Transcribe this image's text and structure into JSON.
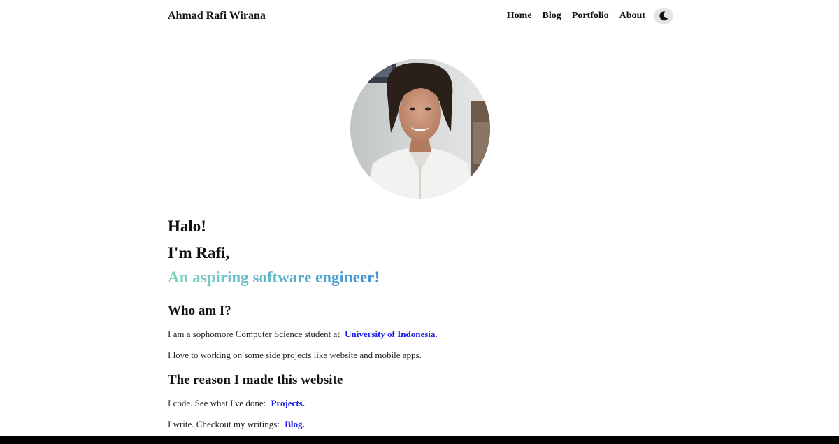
{
  "nav": {
    "brand": "Ahmad Rafi Wirana",
    "links": [
      "Home",
      "Blog",
      "Portfolio",
      "About"
    ],
    "theme_toggle_icon": "moon-icon"
  },
  "hero": {
    "greeting": "Halo!",
    "intro": "I'm Rafi,",
    "tagline": "An aspiring software engineer!",
    "tagline_gradient": [
      "#7dd8c0",
      "#3f90d6"
    ]
  },
  "who": {
    "heading": "Who am I?",
    "line1_text": "I am a sophomore Computer Science student at",
    "line1_link": "University of Indonesia.",
    "line2_text": "I love to working on some side projects like website and mobile apps."
  },
  "reason": {
    "heading": "The reason I made this website",
    "line1_text": "I code. See what I've done:",
    "line1_link": "Projects.",
    "line2_text": "I write. Checkout my writings:",
    "line2_link": "Blog."
  },
  "colors": {
    "link": "#1a1ae6",
    "text": "#111111"
  }
}
